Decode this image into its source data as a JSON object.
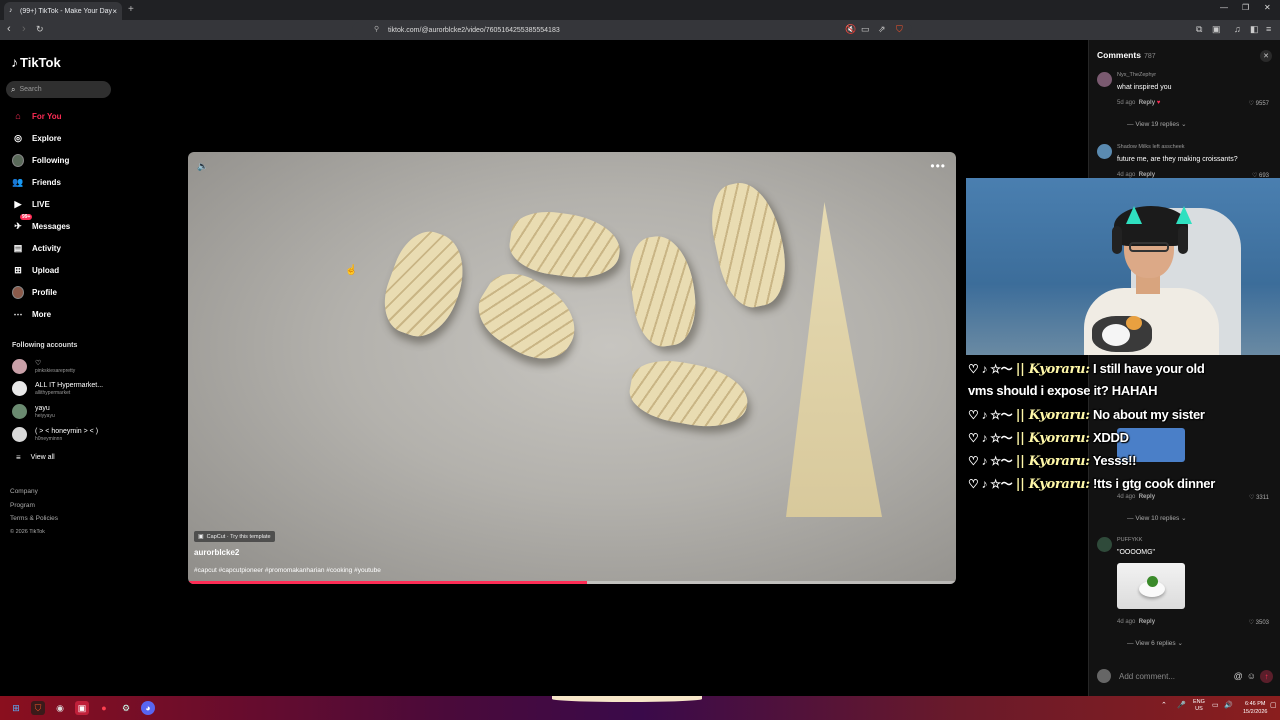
{
  "browser": {
    "tab_title": "(99+) TikTok - Make Your Day",
    "url": "tiktok.com/@aurorblcke2/video/7605164255385554183"
  },
  "sidebar": {
    "logo": "TikTok",
    "search_placeholder": "Search",
    "nav": [
      {
        "label": "For You",
        "icon": "home-icon",
        "active": true
      },
      {
        "label": "Explore",
        "icon": "compass-icon"
      },
      {
        "label": "Following",
        "icon": "avatar-icon"
      },
      {
        "label": "Friends",
        "icon": "friends-icon"
      },
      {
        "label": "LIVE",
        "icon": "live-icon"
      },
      {
        "label": "Messages",
        "icon": "messages-icon",
        "badge": "99+"
      },
      {
        "label": "Activity",
        "icon": "activity-icon"
      },
      {
        "label": "Upload",
        "icon": "upload-icon"
      },
      {
        "label": "Profile",
        "icon": "profile-icon"
      },
      {
        "label": "More",
        "icon": "more-icon"
      }
    ],
    "following_header": "Following accounts",
    "accounts": [
      {
        "name": "♡",
        "handle": "pinkskiesarepretty"
      },
      {
        "name": "ALL IT Hypermarket...",
        "handle": "allithypermarket"
      },
      {
        "name": "yayu",
        "handle": "heiyyayu"
      },
      {
        "name": "( ˃ ˂ honeymin ˃ ˂ )",
        "handle": "h0neyminnn"
      }
    ],
    "view_all": "View all",
    "footer": [
      "Company",
      "Program",
      "Terms & Policies",
      "© 2026 TikTok"
    ]
  },
  "video": {
    "template_label": "CapCut · Try this template",
    "author": "aurorblcke2",
    "hashtags": "#capcut #capcutpioneer #promomakanharian #cooking #youtube",
    "progress": 0.52
  },
  "comments": {
    "title": "Comments",
    "count": "787",
    "items": [
      {
        "user": "Nyx_TheZephyr",
        "text": "what inspired you",
        "time": "5d ago",
        "reply": "Reply",
        "likes": "9557",
        "view_replies": "View 19 replies"
      },
      {
        "user": "Shadow Milks left asscheek",
        "text": "future me, are they making croissants?",
        "time": "4d ago",
        "reply": "Reply",
        "likes": "693"
      },
      {
        "user": "PUFFYKK",
        "text": "\"OOOOMG\"",
        "time": "4d ago",
        "reply": "Reply",
        "likes": "3503",
        "view_replies": "View 6 replies"
      }
    ],
    "partial": {
      "time": "4d ago",
      "reply": "Reply",
      "likes": "3311",
      "view_replies": "View 10 replies"
    },
    "add_placeholder": "Add comment..."
  },
  "chat": {
    "prefix": "♡ ♪ ☆〜",
    "name": "|| Kyoraru:",
    "messages": [
      "I still have your old",
      "vms should i expose it? HAHAH",
      "No about my sister",
      "XDDD",
      "Yesss!!",
      "!tts i gtg cook dinner"
    ]
  },
  "taskbar": {
    "lang1": "ENG",
    "lang2": "US",
    "time": "6:46 PM",
    "date": "15/2/2026"
  }
}
